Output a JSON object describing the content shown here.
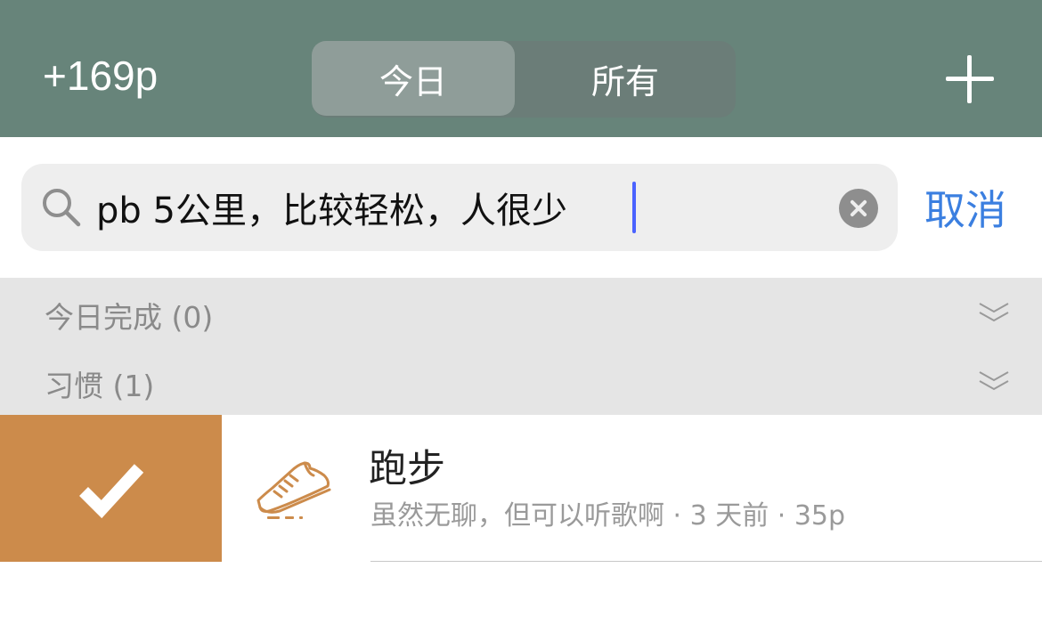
{
  "header": {
    "points": "+169p",
    "tabs": [
      {
        "label": "今日",
        "active": true
      },
      {
        "label": "所有",
        "active": false
      }
    ],
    "add_icon": "plus-icon"
  },
  "search": {
    "value": "pb 5公里，比较轻松，人很少",
    "cancel_label": "取消",
    "search_icon": "magnifier-icon",
    "clear_icon": "clear-circle-icon"
  },
  "sections": [
    {
      "label": "今日完成 (0)"
    },
    {
      "label": "习惯 (1)"
    }
  ],
  "items": [
    {
      "title": "跑步",
      "subtitle": "虽然无聊，但可以听歌啊 · 3 天前 · 35p",
      "icon": "running-shoe-icon"
    }
  ],
  "colors": {
    "header_bg": "#67847a",
    "active_tab_bg": "#8f9d99",
    "complete_action_bg": "#cc8b4b",
    "cancel_text": "#3b7fe0",
    "caret": "#4a62ff"
  }
}
